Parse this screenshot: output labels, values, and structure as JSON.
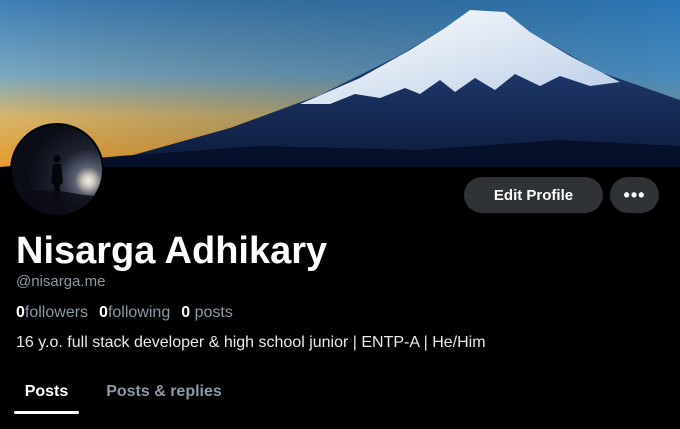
{
  "profile": {
    "name": "Nisarga Adhikary",
    "handle": "@nisarga.me",
    "bio": "16 y.o. full stack developer & high school junior | ENTP-A | He/Him"
  },
  "stats": {
    "followers_count": "0",
    "followers_label": "followers",
    "following_count": "0",
    "following_label": "following",
    "posts_count": "0",
    "posts_label": "posts"
  },
  "actions": {
    "edit_profile_label": "Edit Profile",
    "more_label": "•••"
  },
  "tabs": [
    {
      "label": "Posts",
      "active": true
    },
    {
      "label": "Posts & replies",
      "active": false
    }
  ],
  "colors": {
    "background": "#000000",
    "button_bg": "#2f3336",
    "muted_text": "#8b98a5"
  }
}
